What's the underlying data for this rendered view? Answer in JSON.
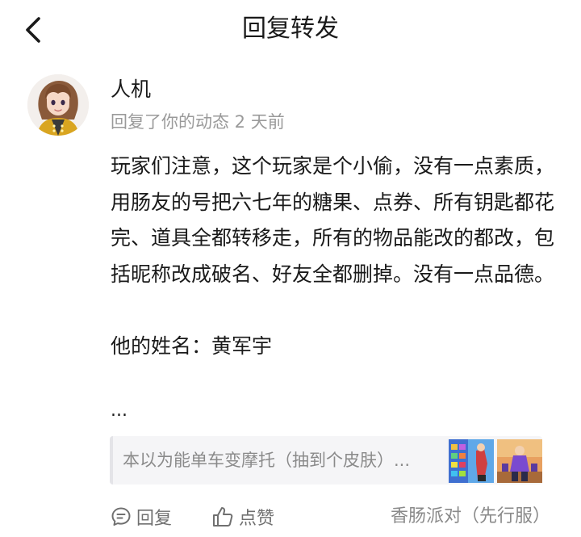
{
  "header": {
    "back_icon": "chevron-left-icon",
    "title": "回复转发"
  },
  "author": {
    "name": "人机",
    "meta": "回复了你的动态 2 天前"
  },
  "content": {
    "paragraph1": "玩家们注意，这个玩家是个小偷，没有一点素质，用肠友的号把六七年的糖果、点券、所有钥匙都花完、道具全都转移走，所有的物品能改的都改，包括昵称改成破名、好友全都删掉。没有一点品德。",
    "paragraph2": "他的姓名：黄军宇",
    "ellipsis": "..."
  },
  "quote": {
    "text": "本以为能单车变摩托（抽到个皮肤）..."
  },
  "footer": {
    "reply_label": "回复",
    "like_label": "点赞",
    "game_label": "香肠派对（先行服）"
  },
  "colors": {
    "text": "#1a1a1a",
    "muted": "#9a9a9a",
    "quote_bg": "#f5f5f7"
  }
}
